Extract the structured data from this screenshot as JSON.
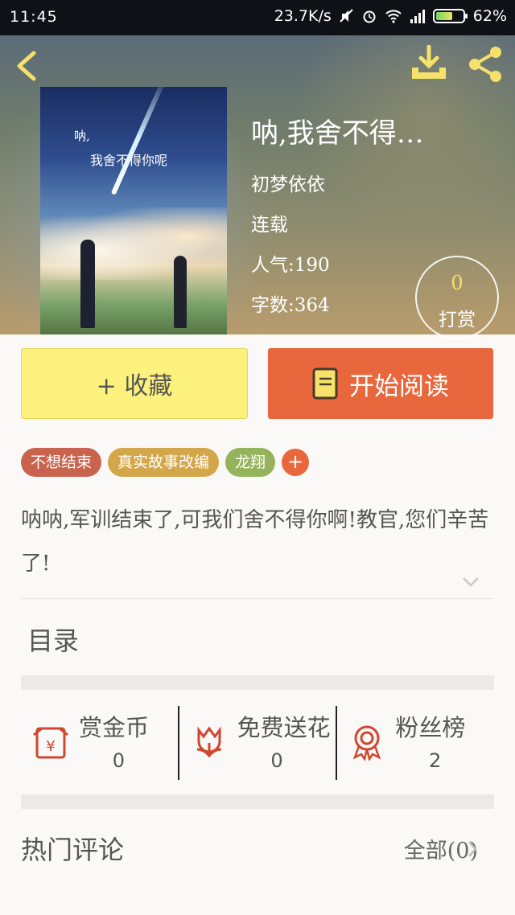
{
  "status_bar": {
    "time": "11:45",
    "speed": "23.7K/s",
    "battery": "62%",
    "battery_level": 0.62
  },
  "header": {
    "icons": [
      "back-icon",
      "download-icon",
      "share-icon"
    ],
    "accent": "#f6e26a"
  },
  "book": {
    "cover_caption_1": "呐,",
    "cover_caption_2": "我舍不得你呢",
    "title": "呐,我舍不得…",
    "author": "初梦依依",
    "status": "连载",
    "popularity": "人气:190",
    "word_count": "字数:364"
  },
  "tip": {
    "count": "0",
    "label": "打赏"
  },
  "actions": {
    "favorite_label": "+ 收藏",
    "read_label": "开始阅读",
    "favorite_color": "#fcf17c",
    "read_color": "#e8673d"
  },
  "tags": [
    {
      "label": "不想结束",
      "color": "#c9634d"
    },
    {
      "label": "真实故事改编",
      "color": "#d4a64a"
    },
    {
      "label": "龙翔",
      "color": "#94b35a"
    }
  ],
  "tag_add": "+",
  "description": "呐呐,军训结束了,可我们舍不得你啊!教官,您们辛苦了!",
  "toc_label": "目录",
  "stats": [
    {
      "label": "赏金币",
      "value": "0",
      "icon": "red-envelope-icon"
    },
    {
      "label": "免费送花",
      "value": "0",
      "icon": "flower-icon"
    },
    {
      "label": "粉丝榜",
      "value": "2",
      "icon": "medal-icon"
    }
  ],
  "comments": {
    "title": "热门评论",
    "all_label": "全部(0)"
  }
}
